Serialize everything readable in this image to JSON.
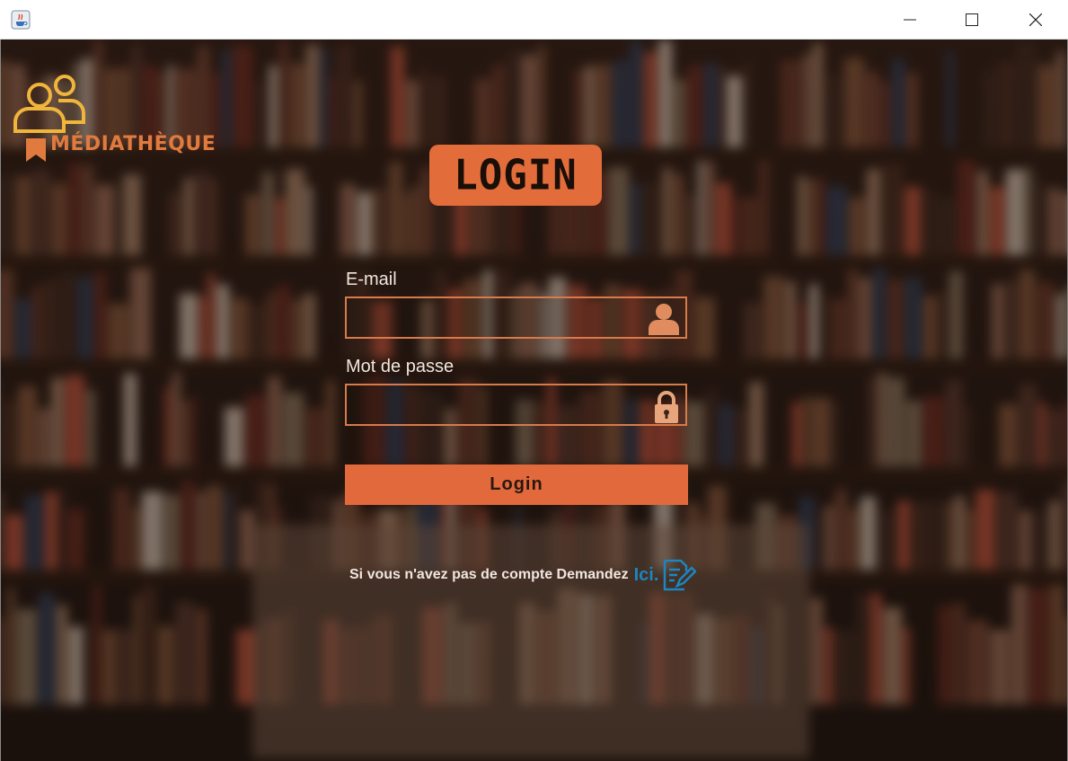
{
  "window": {
    "app_icon": "java-icon",
    "controls": [
      "minimize-icon",
      "maximize-icon",
      "close-icon"
    ]
  },
  "brand": {
    "logo_icon": "users-icon",
    "name": "MÉDIATHÈQUE",
    "color": "#e07a3e"
  },
  "header": {
    "badge": "LOGIN"
  },
  "form": {
    "email_label": "E-mail",
    "email_value": "",
    "email_icon": "user-icon",
    "password_label": "Mot de passe",
    "password_value": "",
    "password_icon": "lock-icon",
    "submit_label": "Login"
  },
  "signup": {
    "text": "Si vous n'avez pas de compte Demandez",
    "link": "Ici.",
    "link_icon": "edit-document-icon",
    "link_color": "#1b86c0"
  },
  "colors": {
    "accent": "#e2693b",
    "field_border": "#d87a4a"
  }
}
